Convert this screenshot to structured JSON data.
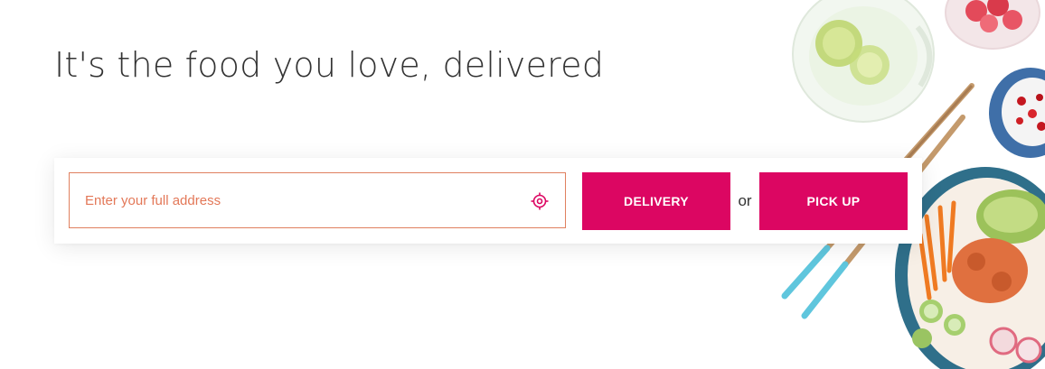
{
  "hero": {
    "headline": "It's the food you love, delivered"
  },
  "search": {
    "placeholder": "Enter your full address",
    "locate_icon": "crosshair-locate-icon",
    "delivery_label": "DELIVERY",
    "separator": "or",
    "pickup_label": "PICK UP"
  },
  "colors": {
    "brand": "#dc0662",
    "input_border": "#e0805f",
    "placeholder": "#e37858",
    "headline": "#333333"
  },
  "decor": {
    "image_subject": "food-bowl-with-chopsticks-and-drinks"
  }
}
